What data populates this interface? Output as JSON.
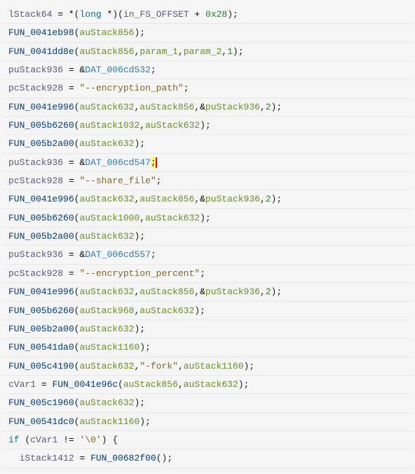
{
  "code": {
    "vars": {
      "lStack64": "lStack64",
      "puStack936": "puStack936",
      "pcStack928": "pcStack928",
      "auStack856": "auStack856",
      "auStack632": "auStack632",
      "auStack1032": "auStack1032",
      "auStack1000": "auStack1000",
      "auStack968": "auStack968",
      "auStack1160": "auStack1160",
      "cVar1": "cVar1",
      "iStack1412": "iStack1412",
      "param_1": "param_1",
      "param_2": "param_2",
      "in_FS_OFFSET": "in_FS_OFFSET"
    },
    "funcs": {
      "FUN_0041eb98": "FUN_0041eb98",
      "FUN_0041dd8e": "FUN_0041dd8e",
      "FUN_0041e996": "FUN_0041e996",
      "FUN_005b6260": "FUN_005b6260",
      "FUN_005b2a00": "FUN_005b2a00",
      "FUN_00541da0": "FUN_00541da0",
      "FUN_005c4190": "FUN_005c4190",
      "FUN_0041e96c": "FUN_0041e96c",
      "FUN_005c1960": "FUN_005c1960",
      "FUN_00541dc0": "FUN_00541dc0",
      "FUN_00682f00": "FUN_00682f00"
    },
    "globals": {
      "DAT_006cd532": "DAT_006cd532",
      "DAT_006cd547": "DAT_006cd547",
      "DAT_006cd557": "DAT_006cd557"
    },
    "strings": {
      "encryption_path": "\"--encryption_path\"",
      "share_file": "\"--share_file\"",
      "encryption_percent": "\"--encryption_percent\"",
      "fork": "\"-fork\"",
      "nul": "'\\0'"
    },
    "nums": {
      "hex28": "0x28",
      "one": "1",
      "two": "2"
    },
    "kw": {
      "long": "long",
      "if": "if"
    }
  }
}
